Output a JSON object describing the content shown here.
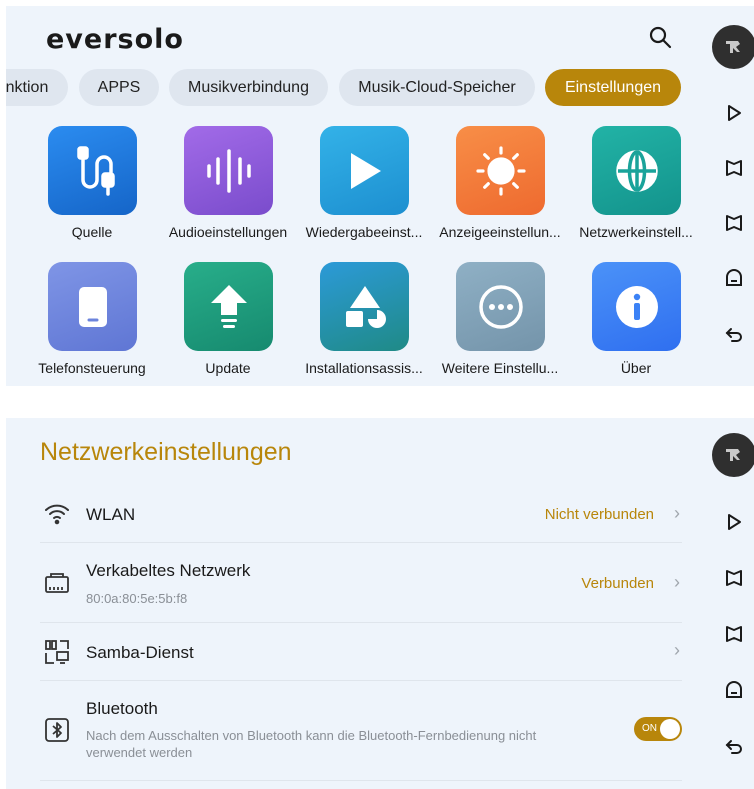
{
  "top": {
    "logo": "eversolo",
    "tabs": [
      {
        "label": "nktion"
      },
      {
        "label": "APPS"
      },
      {
        "label": "Musikverbindung"
      },
      {
        "label": "Musik-Cloud-Speicher"
      },
      {
        "label": "Einstellungen"
      }
    ],
    "tiles": [
      {
        "label": "Quelle",
        "icon": "source-cable-icon",
        "color": "#1a7ad9"
      },
      {
        "label": "Audioeinstellungen",
        "icon": "audio-wave-icon",
        "color": "#8e5bd8"
      },
      {
        "label": "Wiedergabeeinst...",
        "icon": "play-icon",
        "color": "#2aa0d8"
      },
      {
        "label": "Anzeigeeinstellun...",
        "icon": "sun-icon",
        "color": "#f07a3a"
      },
      {
        "label": "Netzwerkeinstell...",
        "icon": "globe-icon",
        "color": "#1aa39a"
      },
      {
        "label": "Telefonsteuerung",
        "icon": "phone-icon",
        "color": "#6c84dc"
      },
      {
        "label": "Update",
        "icon": "upload-icon",
        "color": "#1f9e7f"
      },
      {
        "label": "Installationsassis...",
        "icon": "shapes-icon",
        "color": "#2a8ec9"
      },
      {
        "label": "Weitere Einstellu...",
        "icon": "more-icon",
        "color": "#7f9fb5"
      },
      {
        "label": "Über",
        "icon": "info-icon",
        "color": "#3b82f6"
      }
    ]
  },
  "network": {
    "title": "Netzwerkeinstellungen",
    "rows": {
      "wlan": {
        "title": "WLAN",
        "status": "Nicht verbunden"
      },
      "wired": {
        "title": "Verkabeltes Netzwerk",
        "sub": "80:0a:80:5e:5b:f8",
        "status": "Verbunden"
      },
      "samba": {
        "title": "Samba-Dienst"
      },
      "bluetooth": {
        "title": "Bluetooth",
        "sub": "Nach dem Ausschalten von Bluetooth kann die Bluetooth-Fernbedienung nicht verwendet werden",
        "toggle": "ON"
      }
    }
  },
  "colors": {
    "accent": "#b8860b",
    "background": "#eef4fb"
  }
}
